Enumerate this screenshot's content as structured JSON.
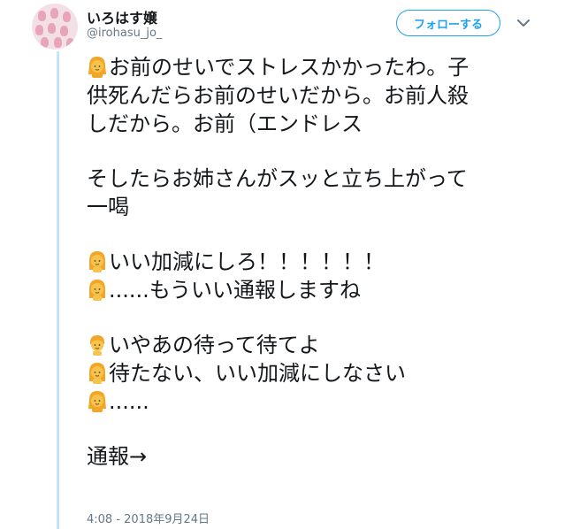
{
  "user": {
    "display_name": "いろはす嬢",
    "handle": "@irohasu_jo_"
  },
  "header": {
    "follow_label": "フォローする"
  },
  "tweet": {
    "lines": [
      "お前のせいでストレスかかったわ。子",
      "供死んだらお前のせいだから。お前人殺",
      "しだから。お前（エンドレス",
      "そしたらお姉さんがスッと立ち上がって",
      "一喝",
      "いい加減にしろ！！！！！！",
      "......もういい通報しますね",
      "いやあの待って待てよ",
      "待たない、いい加減にしなさい",
      "......",
      "通報→"
    ],
    "emojis": {
      "girl": "girl-emoji",
      "woman": "blond-woman-emoji",
      "man": "blond-man-emoji"
    },
    "timestamp": "4:08 - 2018年9月24日"
  },
  "colors": {
    "accent": "#1da1f2",
    "thread_line": "#c4e4f8",
    "muted_text": "#657786",
    "emoji_skin": "#f6c34c",
    "emoji_hair": "#f2a628"
  }
}
